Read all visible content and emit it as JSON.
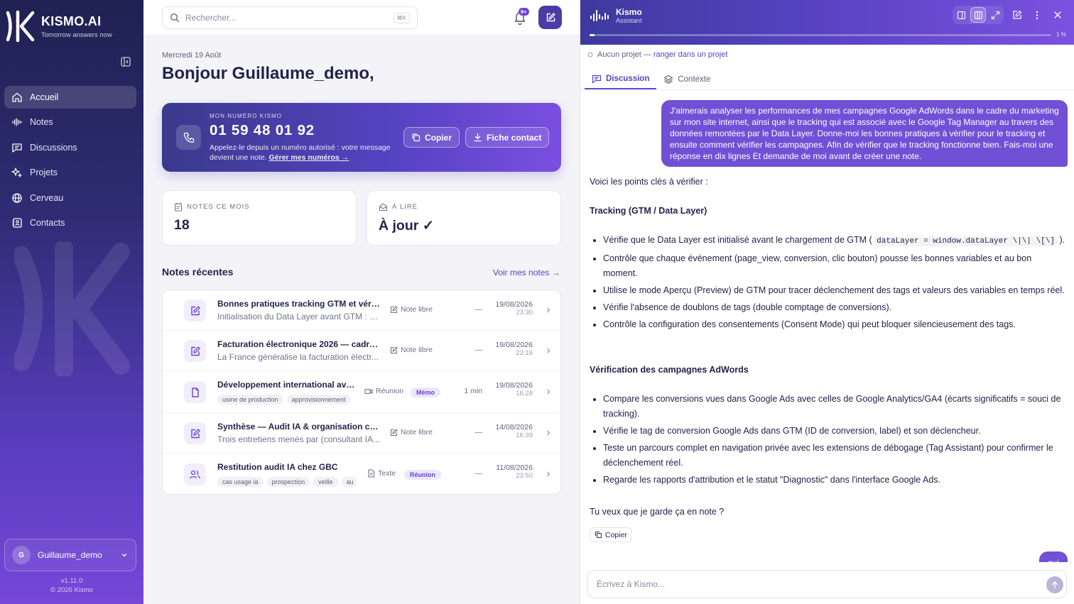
{
  "sidebar": {
    "brand": "KISMO.AI",
    "tagline": "Tomorrow answers now",
    "items": [
      {
        "label": "Accueil",
        "icon": "home-icon",
        "active": true
      },
      {
        "label": "Notes",
        "icon": "waveform-icon"
      },
      {
        "label": "Discussions",
        "icon": "chat-icon"
      },
      {
        "label": "Projets",
        "icon": "sparkles-icon"
      },
      {
        "label": "Cerveau",
        "icon": "globe-icon"
      },
      {
        "label": "Contacts",
        "icon": "contact-book-icon"
      }
    ],
    "user": {
      "initial": "G",
      "name": "Guillaume_demo"
    },
    "version": "v1.11.0",
    "copyright": "© 2026 Kismo"
  },
  "topbar": {
    "search_placeholder": "Rechercher...",
    "search_shortcut": "⌘K",
    "notifications_badge": "9+"
  },
  "home": {
    "date": "Mercredi 19 Août",
    "greeting": "Bonjour Guillaume_demo,",
    "phone": {
      "label": "MON NUMÉRO KISMO",
      "number": "01 59 48 01 92",
      "description": "Appelez-le depuis un numéro autorisé : votre message devient une note.",
      "link": "Gérer mes numéros →",
      "copy_label": "Copier",
      "contact_label": "Fiche contact"
    },
    "stats": [
      {
        "label": "NOTES CE MOIS",
        "value": "18"
      },
      {
        "label": "À LIRE",
        "value": "À jour ✓"
      }
    ],
    "recent_title": "Notes récentes",
    "see_all": "Voir mes notes →"
  },
  "notes": [
    {
      "title": "Bonnes pratiques tracking GTM et vérifi...",
      "subtitle": "Initialisation du Data Layer avant GTM : s'...",
      "tags": [],
      "type": "Note libre",
      "pill": "",
      "duration": "—",
      "date": "19/08/2026",
      "time": "23:30",
      "icon": "edit-note-icon"
    },
    {
      "title": "Facturation électronique 2026 — cadre l...",
      "subtitle": "La France généralise la facturation électr...",
      "tags": [],
      "type": "Note libre",
      "pill": "",
      "duration": "—",
      "date": "19/08/2026",
      "time": "23:16",
      "icon": "edit-note-icon"
    },
    {
      "title": "Développement international avec...",
      "subtitle": "",
      "tags": [
        "usine de production",
        "approvisionnement"
      ],
      "type": "Réunion",
      "pill": "Mémo",
      "duration": "1 min",
      "date": "19/08/2026",
      "time": "16:28",
      "icon": "document-icon"
    },
    {
      "title": "Synthèse — Audit IA & organisation com...",
      "subtitle": "Trois entretiens menés par (consultant IA...",
      "tags": [],
      "type": "Note libre",
      "pill": "",
      "duration": "—",
      "date": "14/08/2026",
      "time": "16:39",
      "icon": "edit-note-icon"
    },
    {
      "title": "Restitution audit IA chez GBC",
      "subtitle": "",
      "tags": [
        "cas usage ia",
        "prospection",
        "veille",
        "au"
      ],
      "type": "Texte",
      "pill": "Réunion",
      "duration": "—",
      "date": "11/08/2026",
      "time": "23:50",
      "icon": "users-icon"
    }
  ],
  "assistant": {
    "name": "Kismo",
    "subtitle": "Assistant",
    "progress": 1,
    "progress_label": "1 %",
    "project_text": "Aucun projet —",
    "project_link": "ranger dans un projet",
    "tabs": [
      "Discussion",
      "Contexte"
    ],
    "user_message": "J'aimerais analyser les performances de mes campagnes Google AdWords dans le cadre du marketing sur mon site internet, ainsi que le tracking qui est associé avec le Google Tag Manager au travers des données remontées par le Data Layer. Donne-moi les bonnes pratiques à vérifier pour le tracking et ensuite comment vérifier les campagnes. Afin de vérifier que le tracking fonctionne bien. Fais-moi une réponse en dix lignes Et demande de moi avant de créer une note.",
    "intro": "Voici les points clés à vérifier :",
    "section1_title": "Tracking (GTM / Data Layer)",
    "s1_b1_pre": "Vérifie que le Data Layer est initialisé avant le chargement de GTM (",
    "s1_b1_code": "dataLayer = window.dataLayer \\|\\| \\[\\]",
    "s1_b1_post": ").",
    "s1_b2": "Contrôle que chaque événement (page_view, conversion, clic bouton) pousse les bonnes variables et au bon moment.",
    "s1_b3": "Utilise le mode Aperçu (Preview) de GTM pour tracer déclenchement des tags et valeurs des variables en temps réel.",
    "s1_b4": "Vérifie l'absence de doublons de tags (double comptage de conversions).",
    "s1_b5": "Contrôle la configuration des consentements (Consent Mode) qui peut bloquer silencieusement des tags.",
    "section2_title": "Vérification des campagnes AdWords",
    "s2_b1": "Compare les conversions vues dans Google Ads avec celles de Google Analytics/GA4 (écarts significatifs = souci de tracking).",
    "s2_b2": "Vérifie le tag de conversion Google Ads dans GTM (ID de conversion, label) et son déclencheur.",
    "s2_b3": "Teste un parcours complet en navigation privée avec les extensions de débogage (Tag Assistant) pour confirmer le déclenchement réel.",
    "s2_b4": "Regarde les rapports d'attribution et le statut \"Diagnostic\" dans l'interface Google Ads.",
    "question": "Tu veux que je garde ça en note ?",
    "copy_label": "Copier",
    "user_reply": "oui",
    "composer_placeholder": "Écrivez à Kismo..."
  },
  "colors": {
    "accent": "#6a42d6",
    "sidebar_top": "#1f2152",
    "sidebar_bottom": "#7747d8"
  }
}
